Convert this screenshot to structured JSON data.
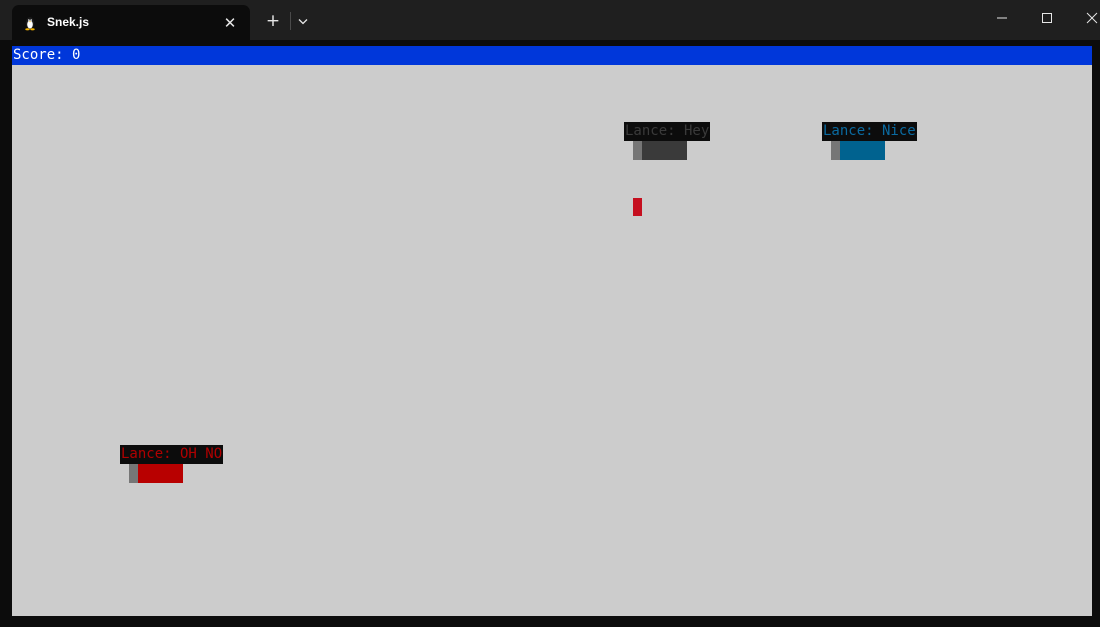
{
  "window": {
    "tab_title": "Snek.js",
    "tab_icon": "linux-penguin-icon",
    "close_tab_glyph": "✕",
    "new_tab_glyph": "+",
    "dropdown_icon": "chevron-down-icon",
    "minimize_icon": "minimize-icon",
    "maximize_icon": "maximize-icon",
    "close_icon": "close-icon"
  },
  "game": {
    "score_text": "Score: 0",
    "score": 0,
    "colors": {
      "playfield": "#cccccc",
      "score_bar": "#0037da",
      "label_background": "#0c0c0c",
      "snake_tail": "#767676",
      "food": "#c50f1f"
    },
    "snakes": [
      {
        "label": "Lance: Hey",
        "label_color": "#3a3a3a",
        "body_color": "#3a3a3a"
      },
      {
        "label": "Lance: Nice",
        "label_color": "#0a6aa0",
        "body_color": "#00628f"
      },
      {
        "label": "Lance: OH NO",
        "label_color": "#b00000",
        "body_color": "#b80000"
      }
    ]
  }
}
